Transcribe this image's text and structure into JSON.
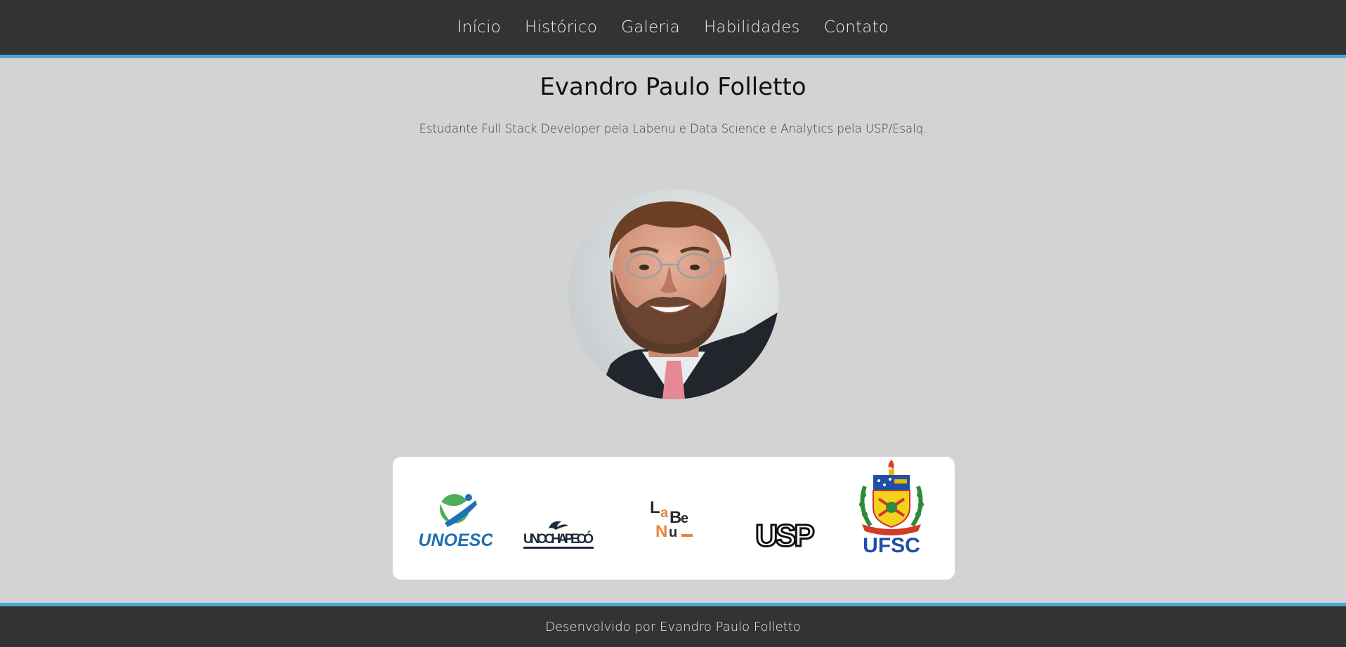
{
  "nav": {
    "items": [
      {
        "label": "Início"
      },
      {
        "label": "Histórico"
      },
      {
        "label": "Galeria"
      },
      {
        "label": "Habilidades"
      },
      {
        "label": "Contato"
      }
    ]
  },
  "hero": {
    "title": "Evandro Paulo Folletto",
    "subtitle": "Estudante Full Stack Developer pela Labenu e Data Science e Analytics pela USP/Esalq."
  },
  "institutions": [
    {
      "name": "UNOESC",
      "icon": "unoesc-logo"
    },
    {
      "name": "UNOCHAPECÓ",
      "icon": "unochapeco-logo"
    },
    {
      "name": "LaBeNu_",
      "icon": "labenu-logo"
    },
    {
      "name": "USP",
      "icon": "usp-logo"
    },
    {
      "name": "UFSC",
      "icon": "ufsc-logo"
    }
  ],
  "footer": {
    "text": "Desenvolvido por Evandro Paulo Folletto"
  },
  "colors": {
    "header_bg": "#333333",
    "accent": "#4fa3d9",
    "page_bg": "#d3d3d3"
  }
}
